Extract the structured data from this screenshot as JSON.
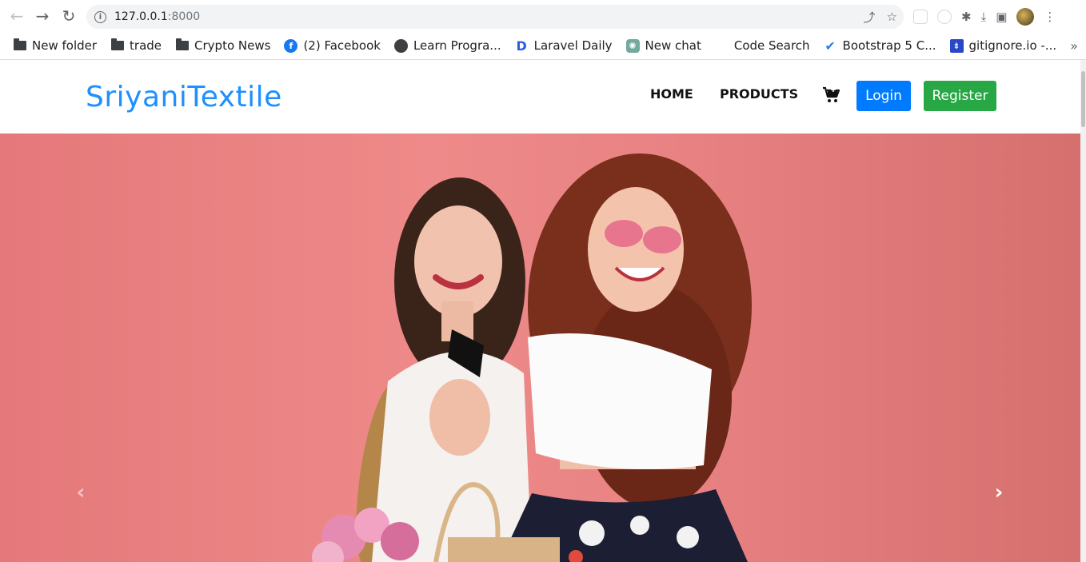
{
  "browser": {
    "url_host": "127.0.0.1",
    "url_port": ":8000",
    "bookmarks": [
      {
        "label": "New folder",
        "icon": "folder-icon"
      },
      {
        "label": "trade",
        "icon": "folder-icon"
      },
      {
        "label": "Crypto News",
        "icon": "folder-icon"
      },
      {
        "label": "(2) Facebook",
        "icon": "facebook-icon"
      },
      {
        "label": "Learn Progra...",
        "icon": "globe-icon"
      },
      {
        "label": "Laravel Daily",
        "icon": "laravel-daily-icon"
      },
      {
        "label": "New chat",
        "icon": "chatgpt-icon"
      },
      {
        "label": "Code Search",
        "icon": "code-search-icon"
      },
      {
        "label": "Bootstrap 5 C...",
        "icon": "bootstrap-check-icon"
      },
      {
        "label": "gitignore.io -...",
        "icon": "gitignore-icon"
      }
    ]
  },
  "site": {
    "brand": "SriyaniTextile",
    "nav": {
      "home": "HOME",
      "products": "PRODUCTS"
    },
    "login_label": "Login",
    "register_label": "Register"
  },
  "carousel": {
    "prev_icon": "chevron-left-icon",
    "next_icon": "chevron-right-icon"
  },
  "colors": {
    "brand": "#1e90ff",
    "login": "#007bff",
    "register": "#28a745",
    "hero_bg": "#e98384"
  }
}
